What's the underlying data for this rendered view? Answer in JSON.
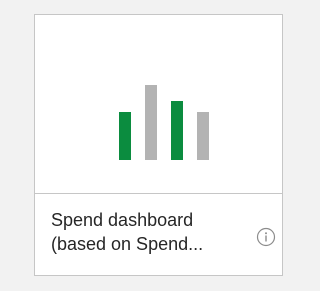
{
  "tile": {
    "title_line1": "Spend dashboard",
    "title_line2": "(based on Spend..."
  },
  "thumbnail": {
    "icon": "bar-chart-icon",
    "bars": [
      {
        "level": 0.53,
        "color": "#0b8c3f"
      },
      {
        "level": 0.83,
        "color": "#b3b3b3"
      },
      {
        "level": 0.66,
        "color": "#0b8c3f"
      },
      {
        "level": 0.53,
        "color": "#b3b3b3"
      }
    ]
  },
  "info": {
    "icon": "info-icon"
  },
  "colors": {
    "background": "#f2f2f2",
    "tile_border": "#c6c6c6",
    "text": "#262626",
    "green": "#0b8c3f",
    "gray": "#b3b3b3"
  }
}
